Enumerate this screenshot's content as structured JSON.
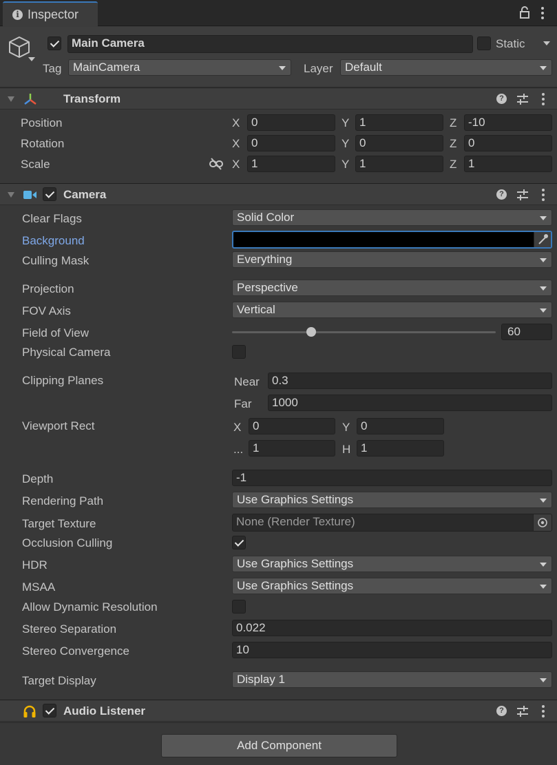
{
  "window": {
    "tab_title": "Inspector"
  },
  "gameobject": {
    "name": "Main Camera",
    "active": true,
    "static_label": "Static",
    "static": false,
    "tag_label": "Tag",
    "tag_value": "MainCamera",
    "layer_label": "Layer",
    "layer_value": "Default"
  },
  "transform": {
    "title": "Transform",
    "position_label": "Position",
    "rotation_label": "Rotation",
    "scale_label": "Scale",
    "position": {
      "x": "0",
      "y": "1",
      "z": "-10"
    },
    "rotation": {
      "x": "0",
      "y": "0",
      "z": "0"
    },
    "scale": {
      "x": "1",
      "y": "1",
      "z": "1"
    }
  },
  "axes": {
    "x": "X",
    "y": "Y",
    "z": "Z",
    "h": "H",
    "w_trunc": "..."
  },
  "camera": {
    "title": "Camera",
    "enabled": true,
    "clear_flags_label": "Clear Flags",
    "clear_flags_value": "Solid Color",
    "background_label": "Background",
    "background_color": "#000000",
    "culling_mask_label": "Culling Mask",
    "culling_mask_value": "Everything",
    "projection_label": "Projection",
    "projection_value": "Perspective",
    "fov_axis_label": "FOV Axis",
    "fov_axis_value": "Vertical",
    "fov_label": "Field of View",
    "fov_value": "60",
    "fov_slider_fraction": 0.3,
    "physical_camera_label": "Physical Camera",
    "physical_camera": false,
    "clipping_label": "Clipping Planes",
    "near_label": "Near",
    "near_value": "0.3",
    "far_label": "Far",
    "far_value": "1000",
    "viewport_label": "Viewport Rect",
    "viewport": {
      "x": "0",
      "y": "0",
      "w": "1",
      "h": "1"
    },
    "depth_label": "Depth",
    "depth_value": "-1",
    "rendering_path_label": "Rendering Path",
    "rendering_path_value": "Use Graphics Settings",
    "target_texture_label": "Target Texture",
    "target_texture_value": "None (Render Texture)",
    "occlusion_label": "Occlusion Culling",
    "occlusion": true,
    "hdr_label": "HDR",
    "hdr_value": "Use Graphics Settings",
    "msaa_label": "MSAA",
    "msaa_value": "Use Graphics Settings",
    "dynres_label": "Allow Dynamic Resolution",
    "dynres": false,
    "stereo_sep_label": "Stereo Separation",
    "stereo_sep_value": "0.022",
    "stereo_conv_label": "Stereo Convergence",
    "stereo_conv_value": "10",
    "target_display_label": "Target Display",
    "target_display_value": "Display 1"
  },
  "audio_listener": {
    "title": "Audio Listener",
    "enabled": true
  },
  "footer": {
    "add_component_label": "Add Component"
  },
  "colors": {
    "panel_bg": "#383838",
    "header_bg": "#3e3e3e",
    "field_bg": "#2a2a2a",
    "dropdown_bg": "#515151",
    "link_blue": "#7fa8e8",
    "camera_icon": "#5ab3e6",
    "audio_icon": "#f0b400"
  },
  "icons": [
    "info-icon",
    "lock-icon",
    "kebab-icon",
    "gameobject-cube-icon",
    "transform-gizmo-icon",
    "help-icon",
    "preset-icon",
    "unlink-icon",
    "camera-icon",
    "eyedropper-icon",
    "object-picker-icon",
    "headphones-icon"
  ]
}
